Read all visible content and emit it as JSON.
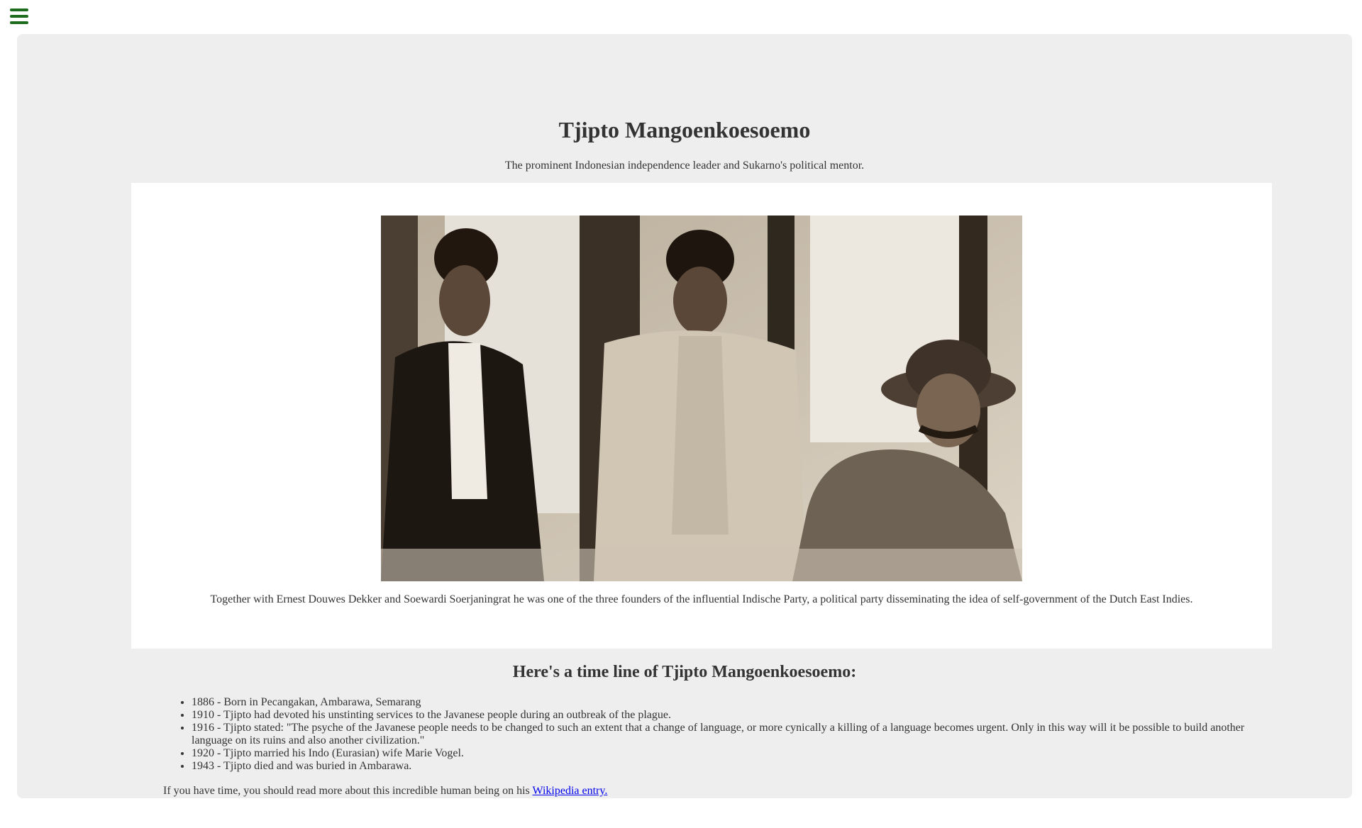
{
  "menu": {
    "icon": "hamburger-menu-icon",
    "color": "#1d6b1d"
  },
  "page": {
    "title": "Tjipto Mangoenkoesoemo",
    "subtitle": "The prominent Indonesian independence leader and Sukarno's political mentor.",
    "figure": {
      "image_description_icon": "sepia-group-photo",
      "caption": "Together with Ernest Douwes Dekker and Soewardi Soerjaningrat he was one of the three founders of the influential Indische Party, a political party disseminating the idea of self-government of the Dutch East Indies."
    },
    "timeline_heading": "Here's a time line of Tjipto Mangoenkoesoemo:",
    "timeline": [
      "1886 - Born in Pecangakan, Ambarawa, Semarang",
      "1910 - Tjipto had devoted his unstinting services to the Javanese people during an outbreak of the plague.",
      "1916 - Tjipto stated: \"The psyche of the Javanese people needs to be changed to such an extent that a change of language, or more cynically a killing of a language becomes urgent. Only in this way will it be possible to build another language on its ruins and also another civilization.\"",
      "1920 - Tjipto married his Indo (Eurasian) wife Marie Vogel.",
      "1943 - Tjipto died and was buried in Ambarawa."
    ],
    "outro_text": "If you have time, you should read more about this incredible human being on his ",
    "outro_link": "Wikipedia entry."
  },
  "colors": {
    "panel_background": "#eeeeee",
    "figure_background": "#ffffff",
    "link": "#0000ee",
    "text": "#333333"
  }
}
